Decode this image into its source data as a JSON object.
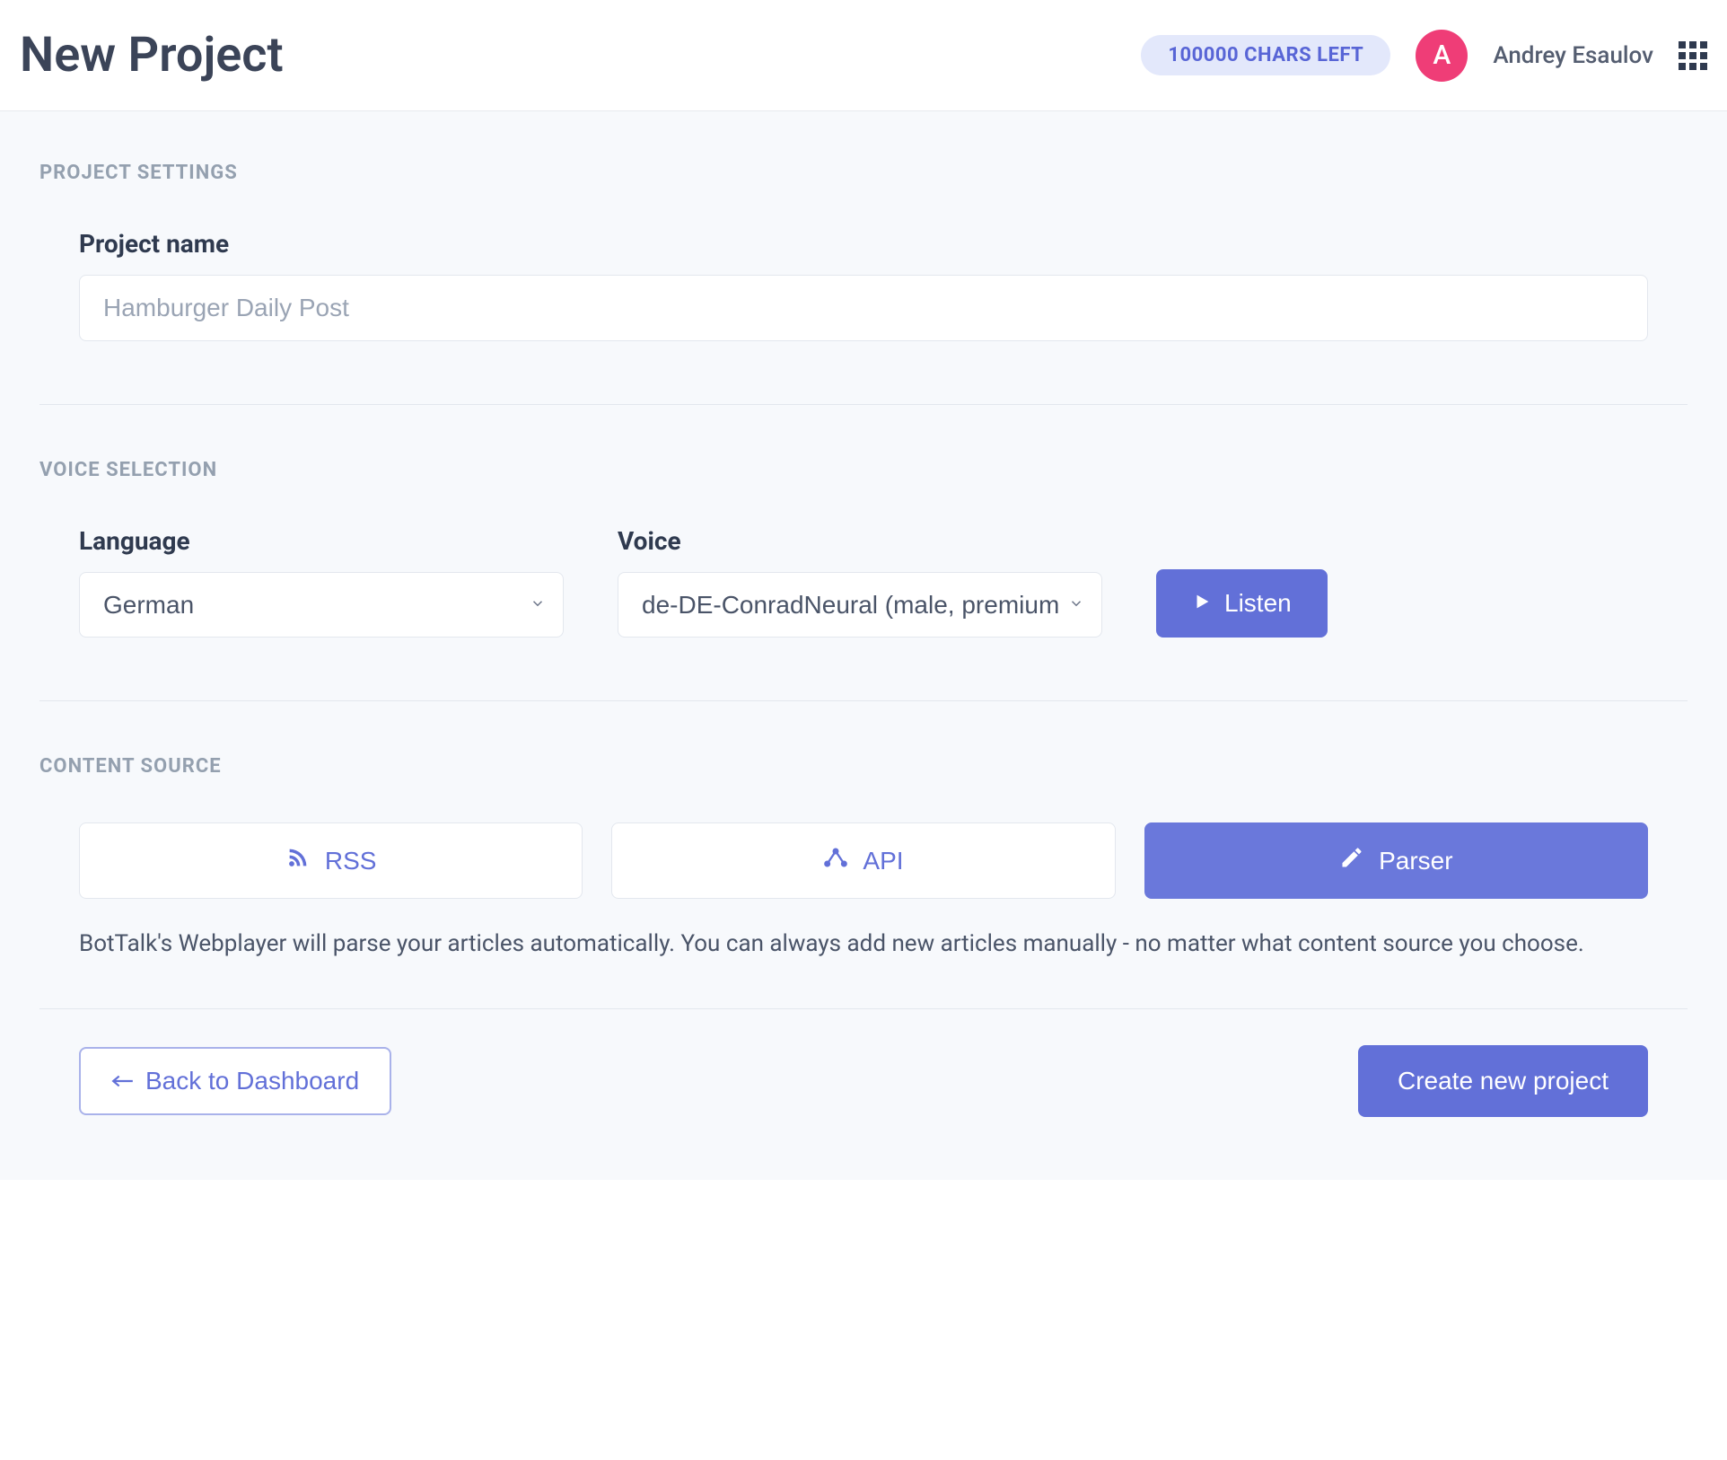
{
  "header": {
    "title": "New Project",
    "chars_left": "100000 CHARS LEFT",
    "user_initial": "A",
    "user_name": "Andrey Esaulov"
  },
  "sections": {
    "settings_label": "PROJECT SETTINGS",
    "voice_label": "VOICE SELECTION",
    "content_label": "CONTENT SOURCE"
  },
  "project_name": {
    "label": "Project name",
    "placeholder": "Hamburger Daily Post",
    "value": ""
  },
  "language": {
    "label": "Language",
    "selected": "German"
  },
  "voice": {
    "label": "Voice",
    "selected": "de-DE-ConradNeural (male, premium)"
  },
  "listen_label": "Listen",
  "sources": {
    "rss": "RSS",
    "api": "API",
    "parser": "Parser"
  },
  "help_text": "BotTalk's Webplayer will parse your articles automatically. You can always add new articles manually - no matter what content source you choose.",
  "footer": {
    "back": "Back to Dashboard",
    "create": "Create new project"
  }
}
